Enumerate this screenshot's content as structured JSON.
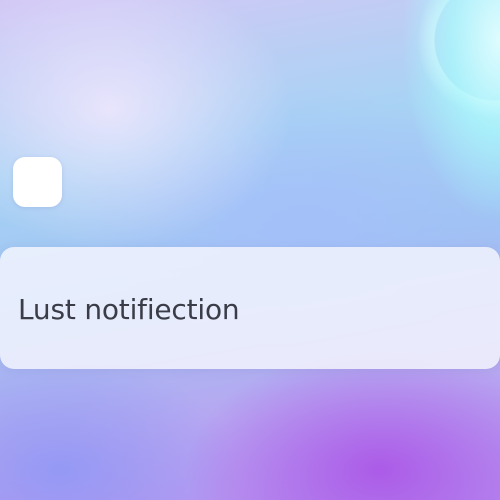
{
  "notification": {
    "text": "Lust notifiection",
    "app_icon": "blank-app-icon"
  },
  "colors": {
    "banner_background": "#f2f3fd",
    "text": "#3a3d48",
    "app_icon_fill": "#ffffff"
  }
}
